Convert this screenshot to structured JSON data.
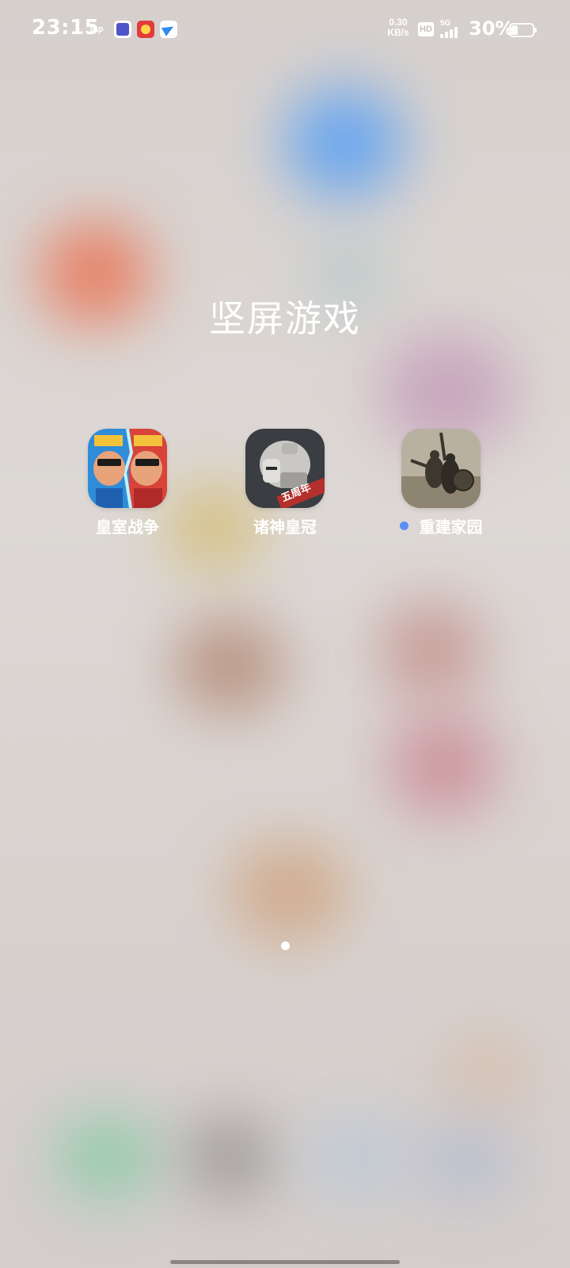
{
  "status_bar": {
    "time": "23:15",
    "notification_icons": [
      "Tap",
      "tieba-icon",
      "game-icon",
      "paper-plane-icon"
    ],
    "tap_label": "Tap",
    "net_speed_value": "0.30",
    "net_speed_unit": "KB/s",
    "hd_badge": "HD",
    "network_type": "5G",
    "battery_percent": "30%",
    "battery_level": 0.3
  },
  "folder": {
    "title": "坚屏游戏",
    "apps": [
      {
        "label": "皇室战争",
        "icon": "clash-royale-icon",
        "new": false
      },
      {
        "label": "诸神皇冠",
        "icon": "gods-crown-icon",
        "new": false
      },
      {
        "label": "重建家园",
        "icon": "rebuild-homeland-icon",
        "new": true
      }
    ],
    "badge_text": "五周年"
  },
  "page_indicator": {
    "pages": 1,
    "current": 1
  },
  "colors": {
    "new_dot": "#5b8ff6",
    "text": "#ffffff"
  }
}
